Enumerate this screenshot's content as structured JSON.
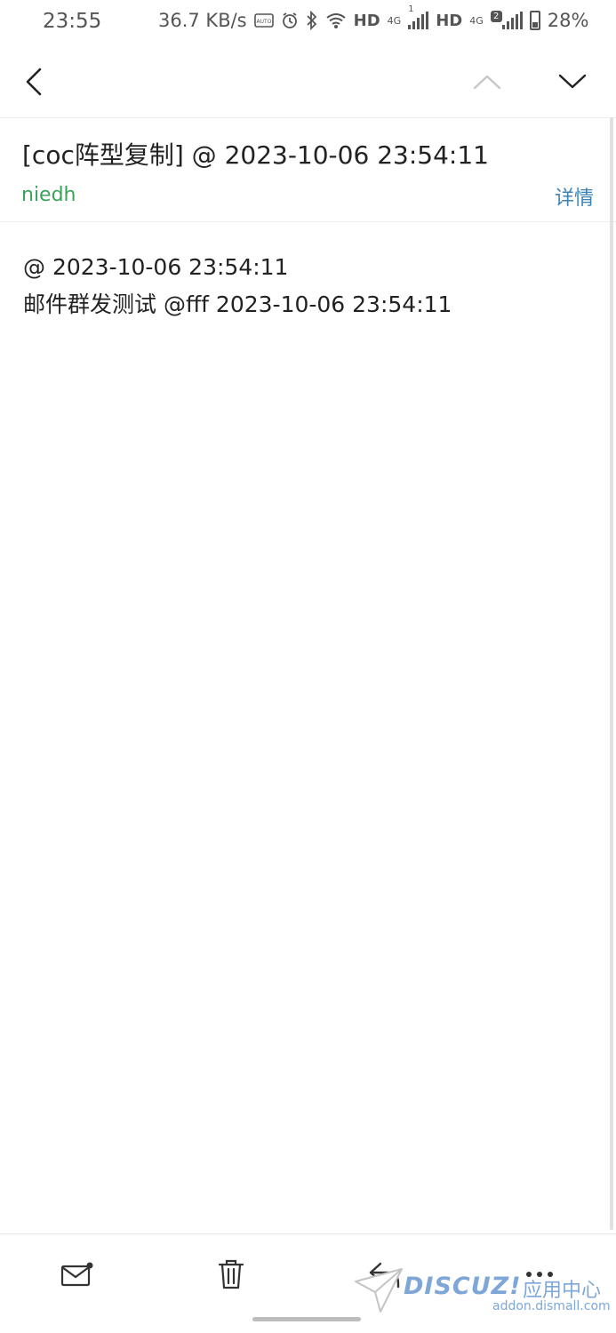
{
  "status_bar": {
    "time": "23:55",
    "net_speed": "36.7 KB/s",
    "hd1": "HD",
    "net1": "4G",
    "sim1": "1",
    "hd2": "HD",
    "net2": "4G",
    "sim2": "2",
    "battery": "28%"
  },
  "email": {
    "subject": "[coc阵型复制]  @ 2023-10-06 23:54:11",
    "sender": "niedh",
    "details_label": "详情",
    "body_lines": [
      "@ 2023-10-06 23:54:11",
      "邮件群发测试 @fff 2023-10-06 23:54:11"
    ]
  },
  "watermark": {
    "logo": "DISCUZ!",
    "cn": "应用中心",
    "url": "addon.dismall.com"
  },
  "colors": {
    "sender": "#3aa35a",
    "details": "#3b83b7",
    "watermark": "#7ea7d8"
  }
}
